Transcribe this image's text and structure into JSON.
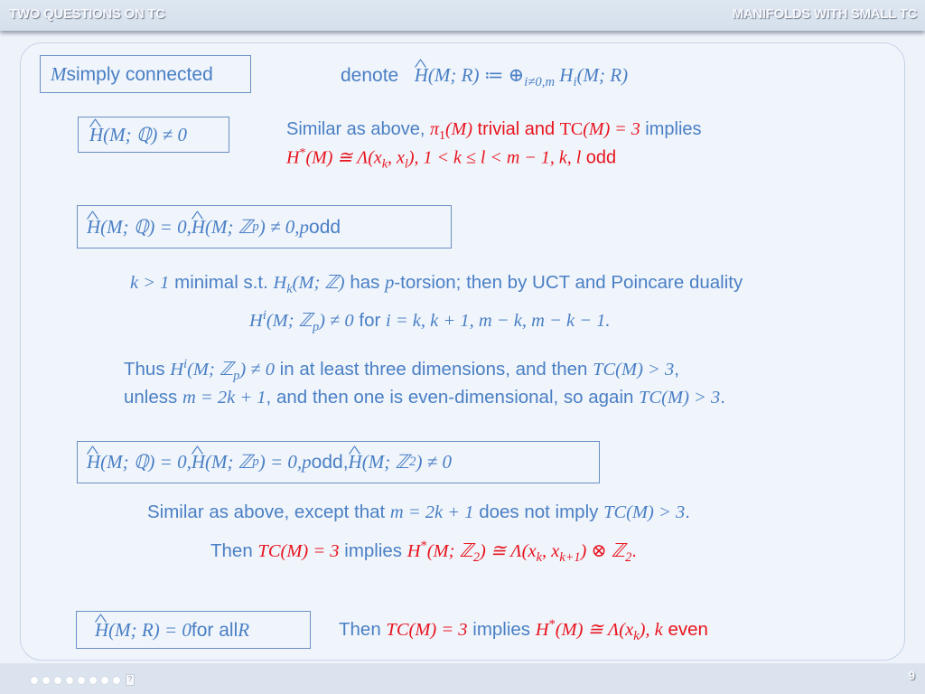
{
  "header": {
    "left_title": "TWO QUESTIONS ON TC",
    "right_title": "MANIFOLDS WITH SMALL TC"
  },
  "footer": {
    "nav_dot_count": 8,
    "nav_box_glyph": "?",
    "page_number": "9"
  },
  "colors": {
    "text_blue": "#4a7fc4",
    "emphasis_red": "#e8141e",
    "box_border": "#6b8fc4",
    "background": "#eef3fa"
  },
  "slide": {
    "box_simply_connected": {
      "math": "M",
      "text": " simply connected"
    },
    "denote": {
      "label": "denote",
      "formula_lhs": "H",
      "formula_lhs_args": "(M; R)",
      "formula_def": " ≔ ⊕",
      "formula_sub": "i≠0,m",
      "formula_rhs": " H",
      "formula_rhs_sub": "i",
      "formula_rhs_args": "(M; R)"
    },
    "case1": {
      "box": {
        "hat_h": "H",
        "args": "(M; ℚ) ≠ 0"
      },
      "line1_prefix": "Similar as above, ",
      "line1_pi": "π",
      "line1_pi_sub": "1",
      "line1_pi_arg": "(M)",
      "line1_trivial": " trivial and ",
      "line1_tc": "TC",
      "line1_tc_arg": "(M) = 3",
      "line1_suffix": "  implies",
      "line2_h": "H",
      "line2_sup": "*",
      "line2_rest": "(M) ≅ Λ(x",
      "line2_sub_k": "k",
      "line2_comma": ", x",
      "line2_sub_l": "l",
      "line2_cond": "),   1 < k ≤ l < m − 1,    k, l",
      "line2_odd": " odd"
    },
    "case2": {
      "box": {
        "part1": "(M; ℚ) = 0,  ",
        "part2": "(M; ℤ",
        "sub_p": "p",
        "part3": ") ≠ 0,  ",
        "p": "p",
        "odd": " odd",
        "hat_h": "H"
      },
      "line1": {
        "k_gt": "k > 1",
        "minimal": " minimal s.t. ",
        "h": "H",
        "h_sub": "k",
        "h_args": "(M; ℤ)",
        "has": " has ",
        "p": "p",
        "rest": "-torsion; then by UCT and Poincare duality"
      },
      "line2": {
        "h": "H",
        "h_sup": "i",
        "h_args": "(M; ℤ",
        "h_sub": "p",
        "neq": ") ≠ 0",
        "for": " for ",
        "values": "i = k, k + 1, m − k, m − k − 1."
      },
      "para": {
        "thus": "Thus ",
        "h": "H",
        "h_sup": "i",
        "h_args": "(M; ℤ",
        "h_sub": "p",
        "neq": ") ≠ 0",
        "dims": " in at least three dimensions, and then ",
        "tc": "TC(M) > 3",
        "comma": ",",
        "unless": "unless ",
        "m_eq": "m = 2k + 1",
        "then_one": ", and then one is even-dimensional, so again ",
        "tc2": "TC(M) > 3",
        "period": "."
      }
    },
    "case3": {
      "box": {
        "hat_h": "H",
        "part1": "(M; ℚ) = 0,  ",
        "part2": "(M; ℤ",
        "sub_p": "p",
        "part3": ") = 0,  ",
        "p": "p",
        "odd": " odd, ",
        "part4": "(M; ℤ",
        "sub_2": "2",
        "part5": ") ≠ 0"
      },
      "line1": {
        "prefix": "Similar as above, except that ",
        "m_eq": "m = 2k + 1",
        "middle": " does not imply ",
        "tc": "TC(M) > 3",
        "period": "."
      },
      "line2": {
        "then": "Then ",
        "tc": "TC(M) = 3",
        "implies": "  implies  ",
        "h": "H",
        "h_sup": "*",
        "h_args": "(M; ℤ",
        "h_sub": "2",
        "iso": ") ≅ Λ(x",
        "sub_k": "k",
        "comma": ", x",
        "sub_k1": "k+1",
        "tensor": ") ⊗ ℤ",
        "sub_2": "2",
        "period": "."
      }
    },
    "case4": {
      "box": {
        "hat_h": "H",
        "args": "(M; R) = 0",
        "for_all": " for all ",
        "r": "R"
      },
      "line": {
        "then": "Then ",
        "tc": "TC(M) = 3",
        "implies": "  implies  ",
        "h": "H",
        "h_sup": "*",
        "h_args": "(M) ≅ Λ(x",
        "sub_k": "k",
        "close": "),  ",
        "k": "k",
        "even": "  even"
      }
    }
  }
}
